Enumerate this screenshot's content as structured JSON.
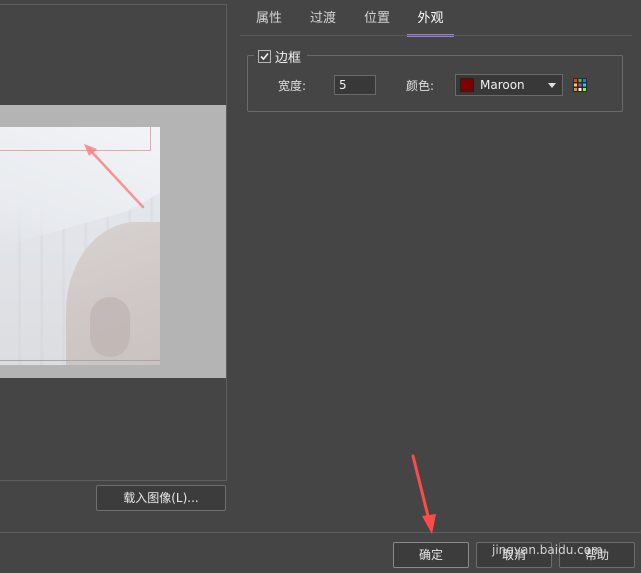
{
  "tabs": [
    {
      "label": "属性"
    },
    {
      "label": "过渡"
    },
    {
      "label": "位置"
    },
    {
      "label": "外观"
    }
  ],
  "active_tab": "外观",
  "border_group": {
    "label": "边框",
    "checked": true,
    "width_label": "宽度:",
    "width_value": "5",
    "color_label": "颜色:",
    "color_name": "Maroon",
    "color_hex": "#800000"
  },
  "load_image_label": "载入图像(L)...",
  "buttons": {
    "ok": "确定",
    "cancel": "取消",
    "help": "帮助"
  },
  "watermark": "jingyan.baidu.com",
  "colors": {
    "background": "#454545",
    "accent": "#9a7ddc",
    "annotation_arrow": "#ff5a5a"
  }
}
